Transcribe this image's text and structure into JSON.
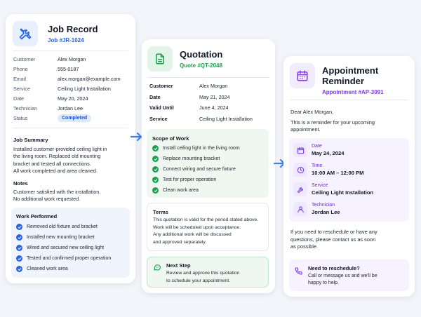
{
  "job": {
    "title": "Job Record",
    "subtitle": "Job #JR-1024",
    "fields": [
      {
        "label": "Customer",
        "value": "Alex Morgan"
      },
      {
        "label": "Phone",
        "value": "555-0187"
      },
      {
        "label": "Email",
        "value": "alex.morgan@example.com"
      },
      {
        "label": "Service",
        "value": "Ceiling Light Installation"
      },
      {
        "label": "Date",
        "value": "May 20, 2024"
      },
      {
        "label": "Technician",
        "value": "Jordan Lee"
      },
      {
        "label": "Status",
        "value": "Completed"
      }
    ],
    "summary_title": "Job Summary",
    "summary_lines": [
      "Installed customer-provided ceiling light in",
      "the living room. Replaced old mounting",
      "bracket and tested all connections.",
      "All work completed and area cleaned."
    ],
    "notes_title": "Notes",
    "notes_lines": [
      "Customer satisfied with the installation.",
      "No additional work requested."
    ],
    "work_title": "Work Performed",
    "work_items": [
      "Removed old fixture and bracket",
      "Installed new mounting bracket",
      "Wired and secured new ceiling light",
      "Tested and confirmed proper operation",
      "Cleaned work area"
    ]
  },
  "quote": {
    "title": "Quotation",
    "subtitle": "Quote #QT-2048",
    "fields": [
      {
        "label": "Customer",
        "value": "Alex Morgan"
      },
      {
        "label": "Date",
        "value": "May 21, 2024"
      },
      {
        "label": "Valid Until",
        "value": "June 4, 2024"
      },
      {
        "label": "Service",
        "value": "Ceiling Light Installation"
      }
    ],
    "scope_title": "Scope of Work",
    "scope_items": [
      "Install ceiling light in the living room",
      "Replace mounting bracket",
      "Connect wiring and secure fixture",
      "Test for proper operation",
      "Clean work area"
    ],
    "terms_title": "Terms",
    "terms_lines": [
      "This quotation is valid for the period stated above.",
      "Work will be scheduled upon acceptance.",
      "Any additional work will be discussed",
      "and approved separately."
    ],
    "next_title": "Next Step",
    "next_lines": [
      "Review and approve this quotation",
      "to schedule your appointment."
    ]
  },
  "appt": {
    "title_line1": "Appointment",
    "title_line2": "Reminder",
    "subtitle": "Appointment #AP-3091",
    "greeting": "Dear Alex Morgan,",
    "intro_lines": [
      "This is a reminder for your upcoming",
      "appointment."
    ],
    "details": [
      {
        "label": "Date",
        "value": "May 24, 2024",
        "icon": "calendar-icon"
      },
      {
        "label": "Time",
        "value": "10:00 AM – 12:00 PM",
        "icon": "clock-icon"
      },
      {
        "label": "Service",
        "value": "Ceiling Light Installation",
        "icon": "wrench-icon"
      },
      {
        "label": "Technician",
        "value": "Jordan Lee",
        "icon": "person-icon"
      }
    ],
    "reschedule_lines": [
      "If you need to reschedule or have any",
      "questions, please contact us as soon",
      "as possible."
    ],
    "help_title": "Need to reschedule?",
    "help_lines": [
      "Call or message us and we'll be",
      "happy to help."
    ]
  },
  "colors": {
    "blue": "#2563eb",
    "green": "#16a34a",
    "purple": "#7c3aed",
    "arrow": "#3b82f6"
  }
}
